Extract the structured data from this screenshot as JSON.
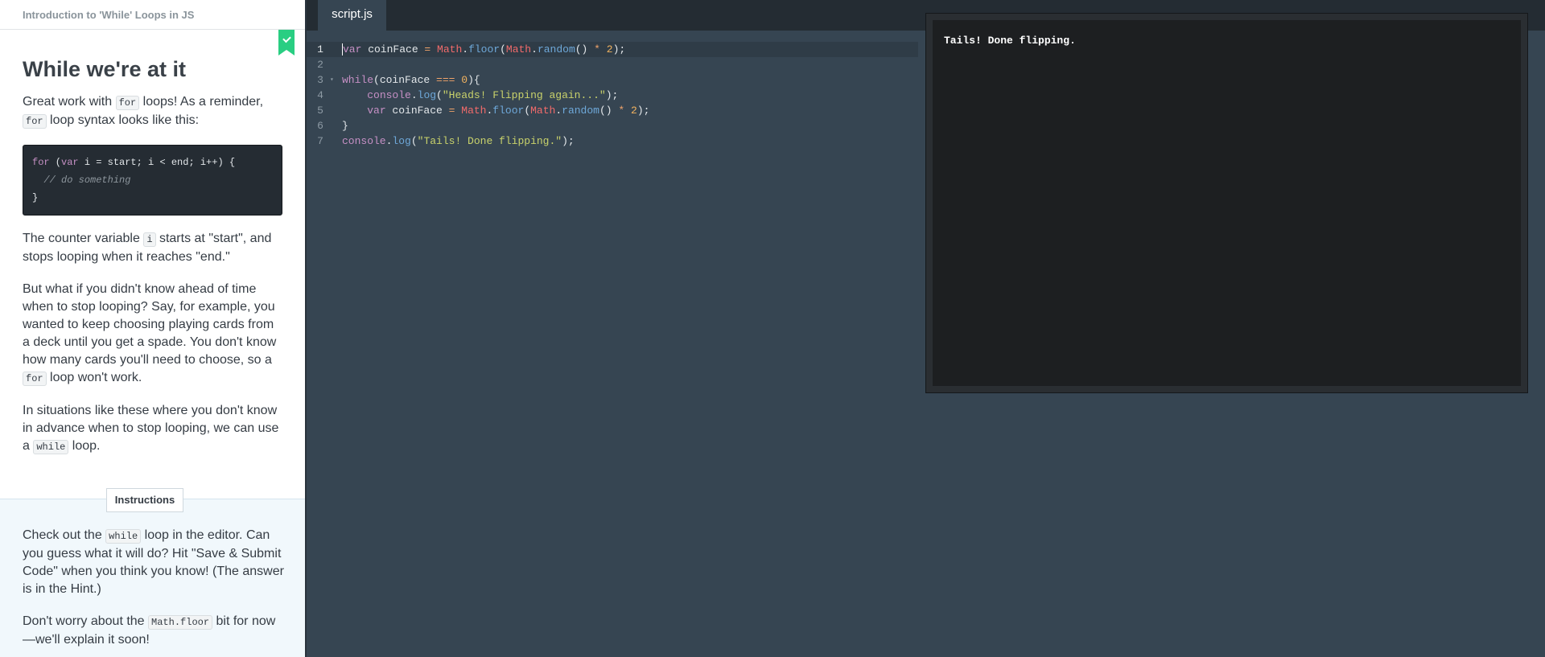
{
  "course": {
    "title": "Introduction to 'While' Loops in JS"
  },
  "lesson": {
    "heading": "While we're at it",
    "p1": {
      "a": "Great work with ",
      "code1": "for",
      "b": " loops! As a reminder, ",
      "code2": "for",
      "c": " loop syntax looks like this:"
    },
    "code_block": {
      "line1": {
        "kw1": "for",
        "a": " (",
        "kw2": "var",
        "b": " i = start; i < end; i++) {"
      },
      "line2": "// do something",
      "line3": "}"
    },
    "p2": {
      "a": "The counter variable ",
      "code": "i",
      "b": " starts at \"start\", and stops looping when it reaches \"end.\""
    },
    "p3": {
      "a": "But what if you didn't know ahead of time when to stop looping? Say, for example, you wanted to keep choosing playing cards from a deck until you get a spade. You don't know how many cards you'll need to choose, so a ",
      "code": "for",
      "b": " loop won't work."
    },
    "p4": {
      "a": "In situations like these where you don't know in advance when to stop looping, we can use a ",
      "code": "while",
      "b": " loop."
    }
  },
  "instructions": {
    "tab_label": "Instructions",
    "p1": {
      "a": "Check out the ",
      "code": "while",
      "b": " loop in the editor. Can you guess what it will do? Hit \"Save & Submit Code\" when you think you know! (The answer is in the Hint.)"
    },
    "p2": {
      "a": "Don't worry about the ",
      "code": "Math.floor",
      "b": " bit for now—we'll explain it soon!"
    }
  },
  "editor": {
    "tab": "script.js",
    "line_numbers": [
      "1",
      "2",
      "3",
      "4",
      "5",
      "6",
      "7"
    ]
  },
  "output": {
    "text": "Tails! Done flipping."
  },
  "colors": {
    "done_flag": "#29ce82",
    "editor_bg": "#364552",
    "output_bg": "#1d1f21"
  }
}
